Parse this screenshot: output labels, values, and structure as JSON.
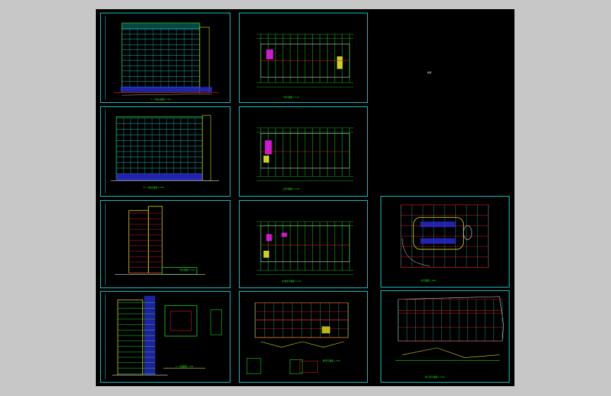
{
  "window": {
    "background": "#c7c7c7",
    "drawing_background": "#000000"
  },
  "colors": {
    "frame": "#19c6c6",
    "line_green": "#19e619",
    "line_yellow": "#e6e619",
    "line_red": "#e61919",
    "line_magenta": "#e619e6",
    "line_blue": "#2b2bd9",
    "line_white": "#e6e6e6"
  },
  "sheets": [
    {
      "id": "elev-front",
      "caption": "①—⑩轴立面图 1:100"
    },
    {
      "id": "plan-1",
      "caption": "一层平面图 1:100"
    },
    {
      "id": "title-note",
      "caption": "说明"
    },
    {
      "id": "elev-rear",
      "caption": "⑩—①轴立面图 1:100"
    },
    {
      "id": "plan-2",
      "caption": "二层平面图 1:100"
    },
    {
      "id": "elev-side",
      "caption": "侧立面图 1:100"
    },
    {
      "id": "plan-3",
      "caption": "标准层平面图 1:100"
    },
    {
      "id": "site-plan",
      "caption": "总平面图 1:500"
    },
    {
      "id": "section",
      "caption": "1—1剖面图 1:100"
    },
    {
      "id": "plan-roof",
      "caption": "屋顶平面图 1:100"
    },
    {
      "id": "plan-basement",
      "caption": "地下室平面图 1:100"
    }
  ]
}
